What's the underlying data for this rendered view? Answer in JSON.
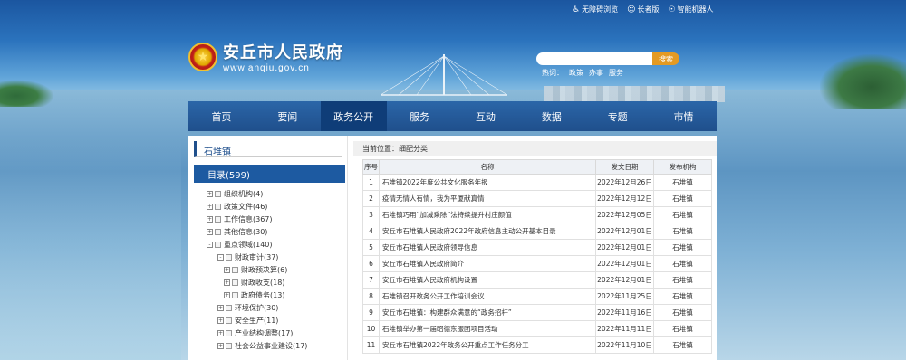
{
  "top_links": [
    {
      "icon": "accessibility-icon",
      "label": "无障碍浏览"
    },
    {
      "icon": "elder-icon",
      "label": "长者版"
    },
    {
      "icon": "robot-icon",
      "label": "智能机器人"
    }
  ],
  "site": {
    "name": "安丘市人民政府",
    "url": "www.anqiu.gov.cn"
  },
  "search": {
    "placeholder": "",
    "button": "搜索",
    "hot_label": "热词：",
    "hot_words": [
      "政策",
      "办事",
      "服务"
    ]
  },
  "nav": [
    "首页",
    "要闻",
    "政务公开",
    "服务",
    "互动",
    "数据",
    "专题",
    "市情"
  ],
  "nav_active": 2,
  "sidebar": {
    "title": "石堆镇",
    "catalog": "目录(599)",
    "tree": [
      {
        "level": 1,
        "exp": "+",
        "label": "组织机构(4)"
      },
      {
        "level": 1,
        "exp": "+",
        "label": "政策文件(46)"
      },
      {
        "level": 1,
        "exp": "+",
        "label": "工作信息(367)"
      },
      {
        "level": 1,
        "exp": "+",
        "label": "其他信息(30)"
      },
      {
        "level": 1,
        "exp": "-",
        "label": "重点领域(140)"
      },
      {
        "level": 2,
        "exp": "-",
        "label": "财政审计(37)"
      },
      {
        "level": 3,
        "exp": "+",
        "label": "财政预决算(6)"
      },
      {
        "level": 3,
        "exp": "+",
        "label": "财政收支(18)"
      },
      {
        "level": 3,
        "exp": "+",
        "label": "政府债务(13)"
      },
      {
        "level": 2,
        "exp": "+",
        "label": "环境保护(30)"
      },
      {
        "level": 2,
        "exp": "+",
        "label": "安全生产(11)"
      },
      {
        "level": 2,
        "exp": "+",
        "label": "产业结构调整(17)"
      },
      {
        "level": 2,
        "exp": "+",
        "label": "社会公益事业建设(17)"
      }
    ]
  },
  "breadcrumb": "当前位置：细配分类",
  "table": {
    "headers": [
      "序号",
      "名称",
      "发文日期",
      "发布机构"
    ],
    "rows": [
      [
        "1",
        "石堆镇2022年度公共文化服务年报",
        "2022年12月26日",
        "石堆镇"
      ],
      [
        "2",
        "疫情无情人有情，我为平厦献真情",
        "2022年12月12日",
        "石堆镇"
      ],
      [
        "3",
        "石堆镇巧用“加减乘除”法持续提升村庄颜值",
        "2022年12月05日",
        "石堆镇"
      ],
      [
        "4",
        "安丘市石堆镇人民政府2022年政府信息主动公开基本目录",
        "2022年12月01日",
        "石堆镇"
      ],
      [
        "5",
        "安丘市石堆镇人民政府领导信息",
        "2022年12月01日",
        "石堆镇"
      ],
      [
        "6",
        "安丘市石堆镇人民政府简介",
        "2022年12月01日",
        "石堆镇"
      ],
      [
        "7",
        "安丘市石堆镇人民政府机构设置",
        "2022年12月01日",
        "石堆镇"
      ],
      [
        "8",
        "石堆镇召开政务公开工作培训会议",
        "2022年11月25日",
        "石堆镇"
      ],
      [
        "9",
        "安丘市石堆镇：构建群众满意的“政务招杆”",
        "2022年11月16日",
        "石堆镇"
      ],
      [
        "10",
        "石堆镇举办第一届昭德东服团项目活动",
        "2022年11月11日",
        "石堆镇"
      ],
      [
        "11",
        "安丘市石堆镇2022年政务公开重点工作任务分工",
        "2022年11月10日",
        "石堆镇"
      ]
    ]
  }
}
